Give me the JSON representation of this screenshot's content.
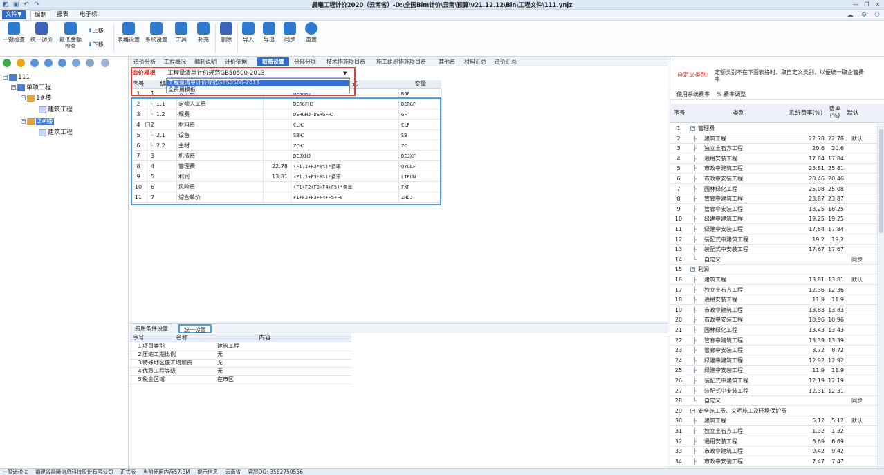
{
  "window": {
    "title": "晨曦工程计价2020（云南省）-D:\\全国Bim计价\\云南\\预算\\v21.12.12\\Bin\\工程文件\\111.ynjz"
  },
  "menu": {
    "tabs": [
      {
        "label": "文件▼"
      },
      {
        "label": "编制"
      },
      {
        "label": "报表"
      },
      {
        "label": "电子标"
      }
    ]
  },
  "ribbon": {
    "buttons": [
      {
        "label": "一键检查"
      },
      {
        "label": "统一调价"
      },
      {
        "label": "最低金额",
        "label2": "检查"
      },
      {
        "label": "表格设置"
      },
      {
        "label": "系统设置"
      },
      {
        "label": "工具"
      },
      {
        "label": "补充"
      },
      {
        "label": "删除"
      },
      {
        "label": "导入"
      },
      {
        "label": "导出"
      },
      {
        "label": "同步"
      },
      {
        "label": "重置"
      }
    ],
    "small": {
      "up": "上移",
      "down": "下移"
    }
  },
  "tree": {
    "items": [
      {
        "label": "111"
      },
      {
        "label": "单项工程"
      },
      {
        "label": "1#楼"
      },
      {
        "label": "建筑工程"
      },
      {
        "label": "2#楼"
      },
      {
        "label": "建筑工程"
      }
    ]
  },
  "main_tabs": [
    {
      "label": "造价分析"
    },
    {
      "label": "工程概况"
    },
    {
      "label": "编制说明"
    },
    {
      "label": "计价依据"
    },
    {
      "label": "取费设置"
    },
    {
      "label": "分部分项"
    },
    {
      "label": "技术措施项目费"
    },
    {
      "label": "施工组织措施项目费"
    },
    {
      "label": "其他费"
    },
    {
      "label": "材料汇总"
    },
    {
      "label": "造价汇总"
    }
  ],
  "template": {
    "label": "造价模板",
    "value": "工程量清单计价规范GB50500-2013",
    "options": [
      "工程量清单计价规范GB50500-2013",
      "全费用模板"
    ]
  },
  "fee_grid": {
    "headers": {
      "seq": "序号",
      "code": "编号",
      "formula": "式",
      "var": "变量"
    },
    "rows": [
      {
        "seq": "1",
        "code": "1",
        "name": "人工费",
        "rate": "",
        "formula": "DERGHJ",
        "var": "RGF"
      },
      {
        "seq": "2",
        "code": "1.1",
        "name": "定额人工费",
        "rate": "",
        "formula": "DERGFHJ",
        "var": "DERGF"
      },
      {
        "seq": "3",
        "code": "1.2",
        "name": "规费",
        "rate": "",
        "formula": "DERGHJ-DERGFHJ",
        "var": "GF"
      },
      {
        "seq": "4",
        "code": "2",
        "name": "材料费",
        "rate": "",
        "formula": "CLHJ",
        "var": "CLF"
      },
      {
        "seq": "5",
        "code": "2.1",
        "name": "设备",
        "rate": "",
        "formula": "SBHJ",
        "var": "SB"
      },
      {
        "seq": "6",
        "code": "2.2",
        "name": "主材",
        "rate": "",
        "formula": "ZCHJ",
        "var": "ZC"
      },
      {
        "seq": "7",
        "code": "3",
        "name": "机械费",
        "rate": "",
        "formula": "DEJXHJ",
        "var": "DEJXF"
      },
      {
        "seq": "8",
        "code": "4",
        "name": "管理费",
        "rate": "22.78",
        "formula": "(F1.1+F3*8%)*费率",
        "var": "QYGLF"
      },
      {
        "seq": "9",
        "code": "5",
        "name": "利润",
        "rate": "13.81",
        "formula": "(F1.1+F3*8%)*费率",
        "var": "LIRUN"
      },
      {
        "seq": "10",
        "code": "6",
        "name": "风险费",
        "rate": "",
        "formula": "(F1+F2+F3+F4+F5)*费率",
        "var": "FXF"
      },
      {
        "seq": "11",
        "code": "7",
        "name": "综合单价",
        "rate": "",
        "formula": "F1+F2+F3+F4+F5+F6",
        "var": "ZHDJ"
      }
    ]
  },
  "bottom": {
    "tabs": [
      {
        "label": "费用条件设置"
      },
      {
        "label": "统一设置"
      }
    ],
    "headers": {
      "seq": "序号",
      "name": "名称",
      "content": "内容"
    },
    "rows": [
      {
        "seq": "1",
        "name": "项目类别",
        "content": "建筑工程"
      },
      {
        "seq": "2",
        "name": "压缩工期比例",
        "content": "无"
      },
      {
        "seq": "3",
        "name": "特殊地区施工增加费",
        "content": "无"
      },
      {
        "seq": "4",
        "name": "优质工程等级",
        "content": "无"
      },
      {
        "seq": "5",
        "name": "税金区域",
        "content": "在市区"
      }
    ]
  },
  "right": {
    "notice_label": "自定义类别:",
    "notice_text": "定额类别不在下面表格时，取自定义类别，以便统一取企管费率",
    "tabs": [
      {
        "label": "使用系统费率"
      },
      {
        "label": "% 费率调整"
      }
    ],
    "headers": {
      "seq": "序号",
      "category": "类别",
      "sys_rate": "系统费率(%)",
      "rate": "费率(%)",
      "default": "默认"
    },
    "rows": [
      {
        "seq": "1",
        "category": "管理费",
        "sys": "",
        "rate": "",
        "def": "",
        "group": true
      },
      {
        "seq": "2",
        "category": "建筑工程",
        "sys": "22.78",
        "rate": "22.78",
        "def": "默认"
      },
      {
        "seq": "3",
        "category": "独立土石方工程",
        "sys": "20.6",
        "rate": "20.6",
        "def": ""
      },
      {
        "seq": "4",
        "category": "通用安装工程",
        "sys": "17.84",
        "rate": "17.84",
        "def": ""
      },
      {
        "seq": "5",
        "category": "市政中建筑工程",
        "sys": "25.81",
        "rate": "25.81",
        "def": ""
      },
      {
        "seq": "6",
        "category": "市政中安装工程",
        "sys": "20.46",
        "rate": "20.46",
        "def": ""
      },
      {
        "seq": "7",
        "category": "园林绿化工程",
        "sys": "25.08",
        "rate": "25.08",
        "def": ""
      },
      {
        "seq": "8",
        "category": "管廊中建筑工程",
        "sys": "23.87",
        "rate": "23.87",
        "def": ""
      },
      {
        "seq": "9",
        "category": "管廊中安装工程",
        "sys": "18.25",
        "rate": "18.25",
        "def": ""
      },
      {
        "seq": "10",
        "category": "绿建中建筑工程",
        "sys": "19.25",
        "rate": "19.25",
        "def": ""
      },
      {
        "seq": "11",
        "category": "绿建中安装工程",
        "sys": "17.84",
        "rate": "17.84",
        "def": ""
      },
      {
        "seq": "12",
        "category": "装配式中建筑工程",
        "sys": "19.2",
        "rate": "19.2",
        "def": ""
      },
      {
        "seq": "13",
        "category": "装配式中安装工程",
        "sys": "17.67",
        "rate": "17.67",
        "def": ""
      },
      {
        "seq": "14",
        "category": "自定义",
        "sys": "",
        "rate": "",
        "def": "同步",
        "last": true
      },
      {
        "seq": "15",
        "category": "利润",
        "sys": "",
        "rate": "",
        "def": "",
        "group": true
      },
      {
        "seq": "16",
        "category": "建筑工程",
        "sys": "13.81",
        "rate": "13.81",
        "def": "默认"
      },
      {
        "seq": "17",
        "category": "独立土石方工程",
        "sys": "12.36",
        "rate": "12.36",
        "def": ""
      },
      {
        "seq": "18",
        "category": "通用安装工程",
        "sys": "11.9",
        "rate": "11.9",
        "def": ""
      },
      {
        "seq": "19",
        "category": "市政中建筑工程",
        "sys": "13.83",
        "rate": "13.83",
        "def": ""
      },
      {
        "seq": "20",
        "category": "市政中安装工程",
        "sys": "10.96",
        "rate": "10.96",
        "def": ""
      },
      {
        "seq": "21",
        "category": "园林绿化工程",
        "sys": "13.43",
        "rate": "13.43",
        "def": ""
      },
      {
        "seq": "22",
        "category": "管廊中建筑工程",
        "sys": "13.39",
        "rate": "13.39",
        "def": ""
      },
      {
        "seq": "23",
        "category": "管廊中安装工程",
        "sys": "8.72",
        "rate": "8.72",
        "def": ""
      },
      {
        "seq": "24",
        "category": "绿建中建筑工程",
        "sys": "12.92",
        "rate": "12.92",
        "def": ""
      },
      {
        "seq": "25",
        "category": "绿建中安装工程",
        "sys": "11.9",
        "rate": "11.9",
        "def": ""
      },
      {
        "seq": "26",
        "category": "装配式中建筑工程",
        "sys": "12.19",
        "rate": "12.19",
        "def": ""
      },
      {
        "seq": "27",
        "category": "装配式中安装工程",
        "sys": "12.31",
        "rate": "12.31",
        "def": ""
      },
      {
        "seq": "28",
        "category": "自定义",
        "sys": "",
        "rate": "",
        "def": "同步",
        "last": true
      },
      {
        "seq": "29",
        "category": "安全施工费、文明施工及环境保护费",
        "sys": "",
        "rate": "",
        "def": "",
        "group": true
      },
      {
        "seq": "30",
        "category": "建筑工程",
        "sys": "5.12",
        "rate": "5.12",
        "def": "默认"
      },
      {
        "seq": "31",
        "category": "独立土石方工程",
        "sys": "1.32",
        "rate": "1.32",
        "def": ""
      },
      {
        "seq": "32",
        "category": "通用安装工程",
        "sys": "6.69",
        "rate": "6.69",
        "def": ""
      },
      {
        "seq": "33",
        "category": "市政中建筑工程",
        "sys": "9.42",
        "rate": "9.42",
        "def": ""
      },
      {
        "seq": "34",
        "category": "市政中安装工程",
        "sys": "7.47",
        "rate": "7.47",
        "def": ""
      }
    ]
  },
  "status": {
    "items": [
      "一般计税法",
      "福建省晨曦信息科技股份有限公司",
      "正式版",
      "当前使用内存57.3M",
      "提示信息",
      "云南省",
      "客服QQ: 3562750556"
    ]
  },
  "colors": {
    "accent": "#2f6fca",
    "highlight_red": "#e0403a",
    "highlight_blue": "#4da0de"
  }
}
